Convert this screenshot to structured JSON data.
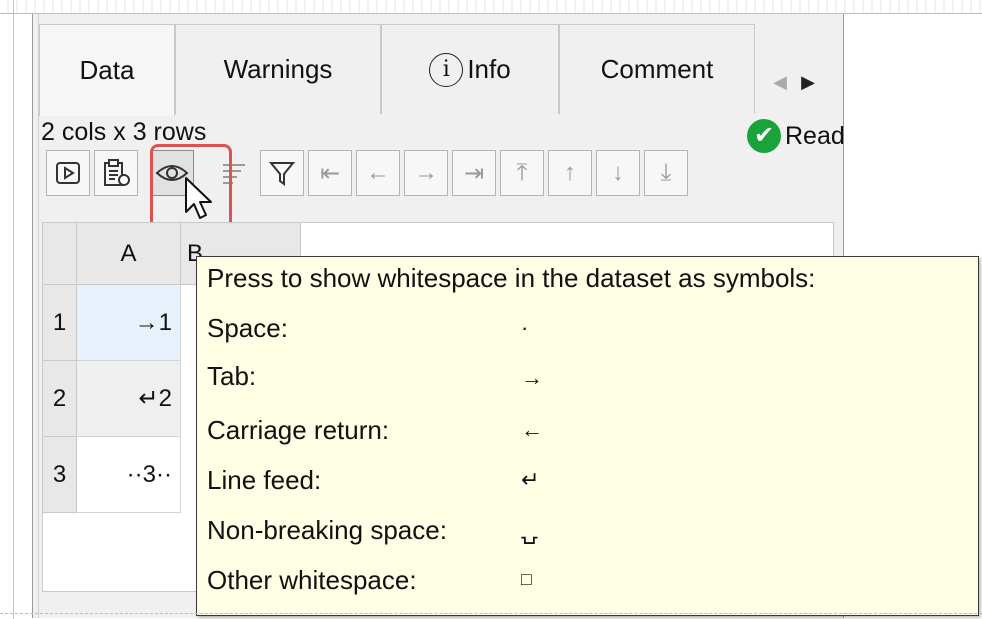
{
  "tabs": [
    {
      "label": "Data",
      "active": true
    },
    {
      "label": "Warnings",
      "active": false
    },
    {
      "label": "Info",
      "icon": "info-icon",
      "active": false
    },
    {
      "label": "Comment",
      "active": false
    }
  ],
  "tab_scroll": {
    "left_icon": "scroll-left-icon",
    "right_icon": "scroll-right-icon"
  },
  "summary": "2 cols x 3 rows",
  "status": {
    "label": "Read",
    "icon": "check-circle-icon",
    "color": "#1aa33a"
  },
  "toolbar": {
    "buttons": [
      "run-icon",
      "paste-icon",
      "show-whitespace-icon",
      "sort-icon",
      "filter-icon",
      "first-column-icon",
      "left-column-icon",
      "right-column-icon",
      "last-column-icon",
      "first-row-icon",
      "up-row-icon",
      "down-row-icon",
      "last-row-icon"
    ],
    "highlight_color": "#e0524f"
  },
  "grid": {
    "columns": [
      "A",
      "B"
    ],
    "rows": [
      {
        "num": "1",
        "a": "→1"
      },
      {
        "num": "2",
        "a": "↵2"
      },
      {
        "num": "3",
        "a": "··3··"
      }
    ]
  },
  "tooltip": {
    "heading": "Press to show whitespace in the dataset as symbols:",
    "items": [
      {
        "label": "Space:",
        "symbol": "·"
      },
      {
        "label": "Tab:",
        "symbol": "→"
      },
      {
        "label": "Carriage return:",
        "symbol": "←"
      },
      {
        "label": "Line feed:",
        "symbol": "↵"
      },
      {
        "label": "Non-breaking space:",
        "symbol": "⍽"
      },
      {
        "label": "Other whitespace:",
        "symbol": "□"
      }
    ]
  }
}
